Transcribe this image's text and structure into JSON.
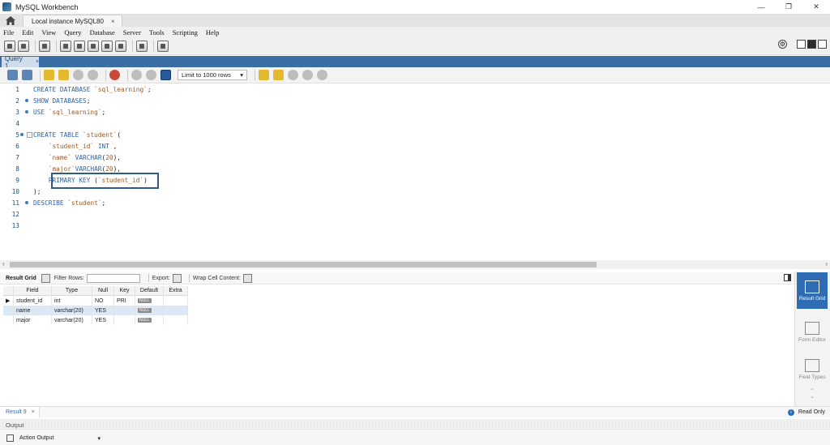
{
  "window": {
    "title": "MySQL Workbench",
    "minimize": "—",
    "restore": "❐",
    "close": "✕"
  },
  "tabs": {
    "instance": "Local instance MySQL80",
    "close": "×"
  },
  "menu": [
    "File",
    "Edit",
    "View",
    "Query",
    "Database",
    "Server",
    "Tools",
    "Scripting",
    "Help"
  ],
  "query_tab": {
    "label": "Query 1",
    "close": "×"
  },
  "editor_toolbar": {
    "limit_label": "Limit to 1000 rows",
    "arrow": "▾"
  },
  "code_lines": [
    {
      "n": "1",
      "text": "CREATE DATABASE `sql_learning`;"
    },
    {
      "n": "2",
      "text": "SHOW DATABASES;"
    },
    {
      "n": "3",
      "text": "USE `sql_learning`;"
    },
    {
      "n": "4",
      "text": ""
    },
    {
      "n": "5",
      "text": "CREATE TABLE `student`("
    },
    {
      "n": "6",
      "text": "    `student_id` INT ,"
    },
    {
      "n": "7",
      "text": "    `name` VARCHAR(20),"
    },
    {
      "n": "8",
      "text": "    `major`VARCHAR(20),"
    },
    {
      "n": "9",
      "text": "    PRIMARY KEY (`student_id`)"
    },
    {
      "n": "10",
      "text": ");"
    },
    {
      "n": "11",
      "text": "DESCRIBE `student`;"
    },
    {
      "n": "12",
      "text": ""
    },
    {
      "n": "13",
      "text": ""
    }
  ],
  "result_toolbar": {
    "grid_label": "Result Grid",
    "filter_label": "Filter Rows:",
    "export_label": "Export:",
    "wrap_label": "Wrap Cell Content:"
  },
  "grid": {
    "columns": [
      "Field",
      "Type",
      "Null",
      "Key",
      "Default",
      "Extra"
    ],
    "rows": [
      [
        "student_id",
        "int",
        "NO",
        "PRI",
        "NULL",
        ""
      ],
      [
        "name",
        "varchar(20)",
        "YES",
        "",
        "NULL",
        ""
      ],
      [
        "major",
        "varchar(20)",
        "YES",
        "",
        "NULL",
        ""
      ]
    ]
  },
  "side_panel": {
    "result_grid": "Result Grid",
    "form_editor": "Form Editor",
    "field_types": "Field Types"
  },
  "result_tab": {
    "label": "Result 9",
    "close": "×"
  },
  "status": {
    "read_only": "Read Only",
    "info": "i"
  },
  "output": {
    "header": "Output",
    "select": "Action Output",
    "arrow": "▾"
  }
}
